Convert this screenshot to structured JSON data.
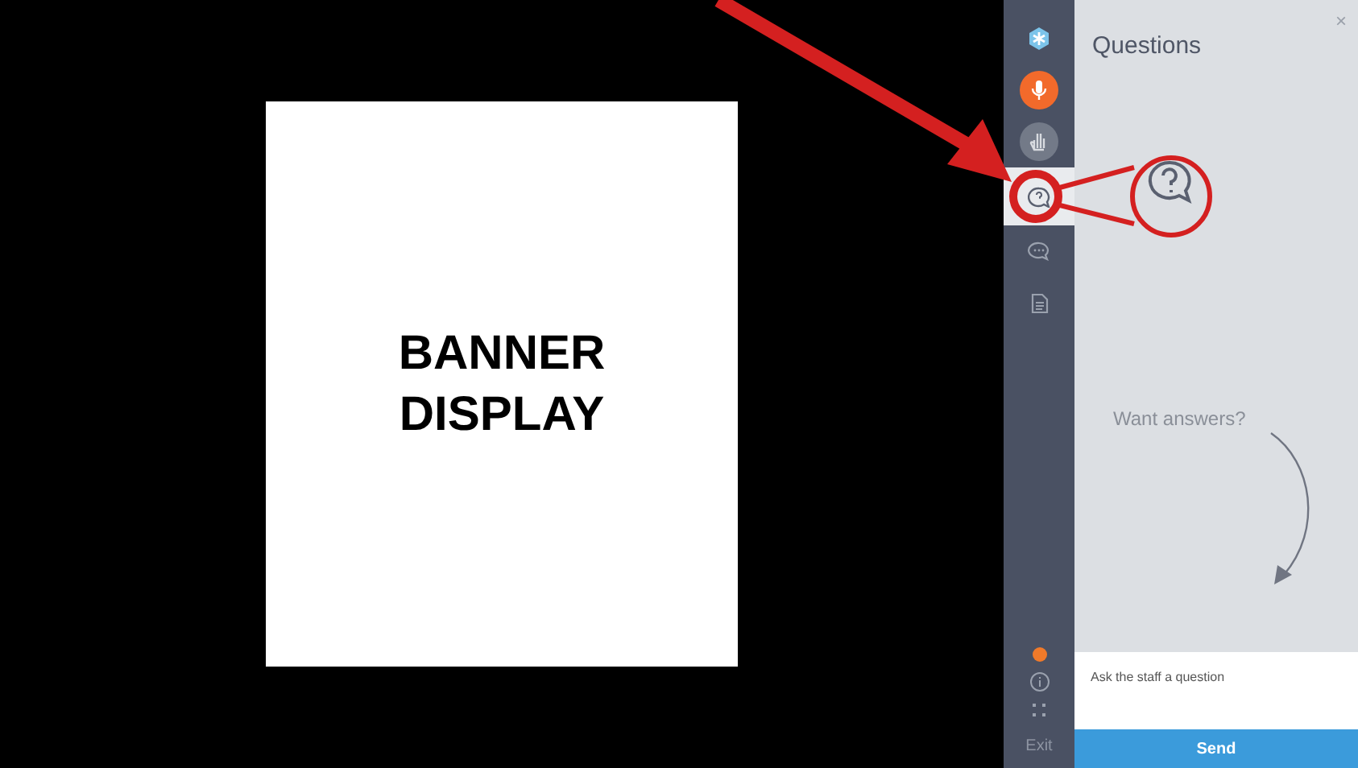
{
  "stage": {
    "banner": {
      "text": "BANNER DISPLAY"
    }
  },
  "sidebar": {
    "items": [
      {
        "kind": "logo",
        "selected": false
      },
      {
        "kind": "mic",
        "selected": false
      },
      {
        "kind": "hand",
        "selected": false
      },
      {
        "kind": "question",
        "selected": true
      },
      {
        "kind": "chat",
        "selected": false
      },
      {
        "kind": "document",
        "selected": false
      }
    ],
    "footer": [
      {
        "kind": "status-dot"
      },
      {
        "kind": "info"
      },
      {
        "kind": "grid"
      },
      {
        "kind": "text",
        "label": "Exit"
      }
    ]
  },
  "panel": {
    "title": "Questions",
    "close": "×",
    "prompt": "Want answers?",
    "input": {
      "placeholder": "Ask the staff a question"
    },
    "button": "Send"
  }
}
